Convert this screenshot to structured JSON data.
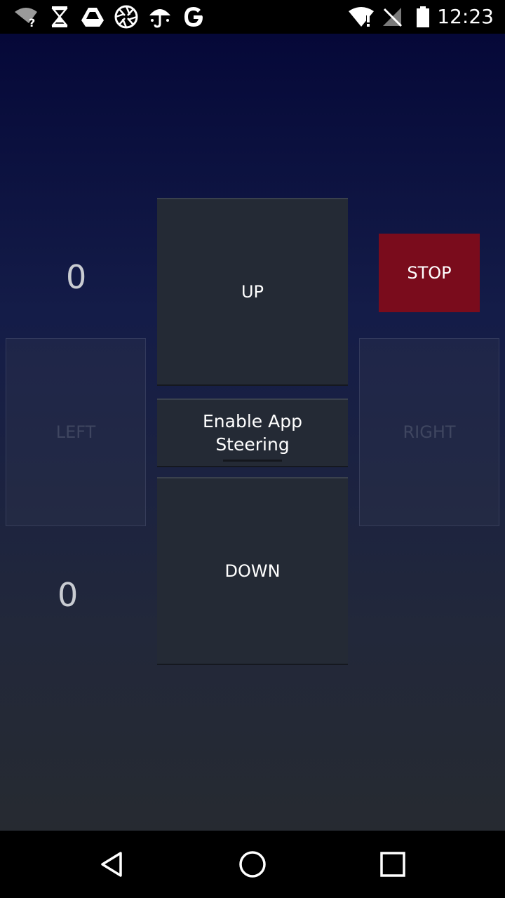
{
  "status_bar": {
    "time": "12:23",
    "icons": [
      "wifi-question-icon",
      "hourglass-icon",
      "drive-icon",
      "aperture-icon",
      "umbrella-icon",
      "google-icon",
      "wifi-alert-icon",
      "no-signal-icon",
      "battery-icon"
    ]
  },
  "controls": {
    "up_label": "UP",
    "down_label": "DOWN",
    "left_label": "LEFT",
    "right_label": "RIGHT",
    "stop_label": "STOP",
    "enable_label": "Enable App Steering",
    "counter_top": "0",
    "counter_bottom": "0"
  },
  "colors": {
    "stop": "#7a0c1c",
    "button": "#242a35",
    "background_top": "#050838",
    "background_bottom": "#262a31"
  },
  "nav_bar": {
    "back": "back-icon",
    "home": "home-icon",
    "recents": "recents-icon"
  }
}
